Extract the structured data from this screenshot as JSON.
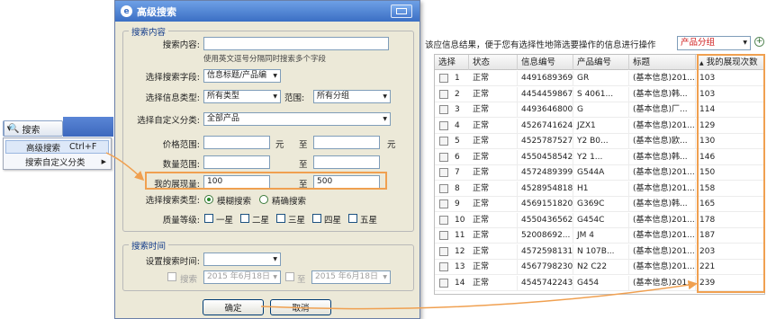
{
  "left_widget": {
    "search_button_label": "搜索",
    "menu": [
      {
        "label": "高级搜索",
        "shortcut": "Ctrl+F"
      },
      {
        "label": "搜索自定义分类"
      }
    ]
  },
  "dialog": {
    "title": "高级搜索",
    "section_content": "搜索内容",
    "search_content_label": "搜索内容:",
    "search_content_value": "",
    "search_hint": "使用英文逗号分隔同时搜索多个字段",
    "search_field_label": "选择搜索字段:",
    "search_field_value": "信息标题/产品编",
    "info_type_label": "选择信息类型:",
    "info_type_value": "所有类型",
    "scope_label": "范围:",
    "scope_value": "所有分组",
    "custom_cat_label": "选择自定义分类:",
    "custom_cat_value": "全部产品",
    "price_label": "价格范围:",
    "price_unit": "元",
    "to_label": "至",
    "qty_label": "数量范围:",
    "display_label": "我的展现量:",
    "display_from": "100",
    "display_to": "500",
    "search_type_label": "选择搜索类型:",
    "search_types": [
      "模糊搜索",
      "精确搜索"
    ],
    "quality_label": "质量等级:",
    "quality_levels": [
      "一星",
      "二星",
      "三星",
      "四星",
      "五星"
    ],
    "section_time": "搜索时间",
    "set_time_label": "设置搜索时间:",
    "time_value": "",
    "search_cb_label": "搜索",
    "date_from": "2015 年6月18日",
    "date_to": "2015 年6月18日",
    "ok_label": "确定",
    "cancel_label": "取消"
  },
  "results": {
    "header_text": "该应信息结果，便于您有选择性地筛选要操作的信息进行操作",
    "filter_value": "产品分组",
    "columns": [
      "选择",
      "状态",
      "信息编号",
      "产品编号",
      "标题",
      "我的展现次数"
    ],
    "rows": [
      {
        "n": "1",
        "status": "正常",
        "id": "44916893697",
        "prod": "GR",
        "title": "(基本信息)201...",
        "count": "103"
      },
      {
        "n": "2",
        "status": "正常",
        "id": "44544598670",
        "prod": "S   4061...",
        "title": "(基本信息)韩...",
        "count": "103"
      },
      {
        "n": "3",
        "status": "正常",
        "id": "44936468004",
        "prod": "G",
        "title": "(基本信息)厂...",
        "count": "114"
      },
      {
        "n": "4",
        "status": "正常",
        "id": "45267416247",
        "prod": "JZX1",
        "title": "(基本信息)201...",
        "count": "129"
      },
      {
        "n": "5",
        "status": "正常",
        "id": "45257875273",
        "prod": "Y2    B0...",
        "title": "(基本信息)欧...",
        "count": "130"
      },
      {
        "n": "6",
        "status": "正常",
        "id": "45504585421",
        "prod": "Y2    1...",
        "title": "(基本信息)韩...",
        "count": "146"
      },
      {
        "n": "7",
        "status": "正常",
        "id": "45724893992",
        "prod": "G544A",
        "title": "(基本信息)201...",
        "count": "150"
      },
      {
        "n": "8",
        "status": "正常",
        "id": "45289548180",
        "prod": "H1",
        "title": "(基本信息)201...",
        "count": "158"
      },
      {
        "n": "9",
        "status": "正常",
        "id": "45691518205",
        "prod": "G369C",
        "title": "(基本信息)韩...",
        "count": "165"
      },
      {
        "n": "10",
        "status": "正常",
        "id": "45504365627",
        "prod": "G454C",
        "title": "(基本信息)201...",
        "count": "178"
      },
      {
        "n": "11",
        "status": "正常",
        "id": "52008692...",
        "prod": "JM   4",
        "title": "(基本信息)201...",
        "count": "187"
      },
      {
        "n": "12",
        "status": "正常",
        "id": "45725981316",
        "prod": "N   107B...",
        "title": "(基本信息)201...",
        "count": "203"
      },
      {
        "n": "13",
        "status": "正常",
        "id": "45677982301",
        "prod": "N2   C22",
        "title": "(基本信息)201...",
        "count": "221"
      },
      {
        "n": "14",
        "status": "正常",
        "id": "45457422432",
        "prod": "G454",
        "title": "(基本信息)201...",
        "count": "239"
      }
    ]
  },
  "colors": {
    "highlight_border": "#f0a050",
    "title_blue": "#3b6fc4"
  }
}
